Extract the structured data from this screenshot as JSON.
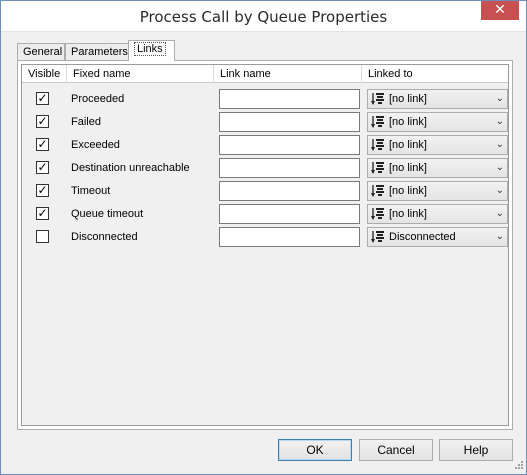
{
  "window": {
    "title": "Process Call by Queue Properties",
    "close_glyph": "✕"
  },
  "tabs": [
    {
      "label": "General"
    },
    {
      "label": "Parameters"
    },
    {
      "label": "Links"
    }
  ],
  "grid": {
    "columns": [
      "Visible",
      "Fixed name",
      "Link name",
      "Linked to"
    ],
    "rows": [
      {
        "visible": true,
        "fixed_name": "Proceeded",
        "link_name": "",
        "linked_to": "[no link]"
      },
      {
        "visible": true,
        "fixed_name": "Failed",
        "link_name": "",
        "linked_to": "[no link]"
      },
      {
        "visible": true,
        "fixed_name": "Exceeded",
        "link_name": "",
        "linked_to": "[no link]"
      },
      {
        "visible": true,
        "fixed_name": "Destination unreachable",
        "link_name": "",
        "linked_to": "[no link]"
      },
      {
        "visible": true,
        "fixed_name": "Timeout",
        "link_name": "",
        "linked_to": "[no link]"
      },
      {
        "visible": true,
        "fixed_name": "Queue timeout",
        "link_name": "",
        "linked_to": "[no link]"
      },
      {
        "visible": false,
        "fixed_name": "Disconnected",
        "link_name": "",
        "linked_to": "Disconnected"
      }
    ],
    "check_glyph": "✓",
    "chevron_glyph": "⌄",
    "link_icon": "link-target-icon"
  },
  "buttons": {
    "ok": "OK",
    "cancel": "Cancel",
    "help": "Help"
  },
  "colors": {
    "close": "#c75050",
    "default_button_border": "#3c7fb1",
    "window_border": "#6d8dba"
  }
}
